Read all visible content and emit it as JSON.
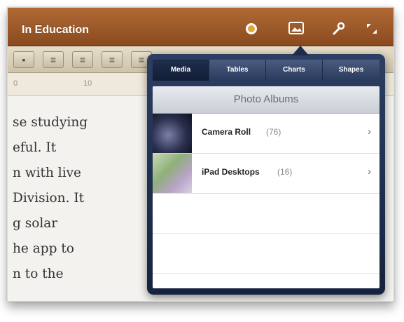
{
  "toolbar": {
    "document_title": "In Education",
    "icons": [
      "info-icon",
      "image-icon",
      "wrench-icon",
      "fullscreen-icon"
    ]
  },
  "format_bar": {
    "buttons": [
      "align-left",
      "align-center",
      "align-right",
      "justify"
    ]
  },
  "ruler": {
    "marks": [
      "0",
      "10"
    ]
  },
  "document": {
    "lines": [
      "se studying",
      "eful. It",
      "n with live",
      "Division. It",
      "g solar",
      "he app to",
      "n to the"
    ]
  },
  "popover": {
    "tabs": [
      {
        "label": "Media",
        "active": true
      },
      {
        "label": "Tables",
        "active": false
      },
      {
        "label": "Charts",
        "active": false
      },
      {
        "label": "Shapes",
        "active": false
      }
    ],
    "header": "Photo Albums",
    "albums": [
      {
        "name": "Camera Roll",
        "count": "(76)"
      },
      {
        "name": "iPad Desktops",
        "count": "(16)"
      }
    ]
  },
  "colors": {
    "toolbar": "#9a5628",
    "popover": "#1c2c4a",
    "page": "#f4f2ee"
  }
}
